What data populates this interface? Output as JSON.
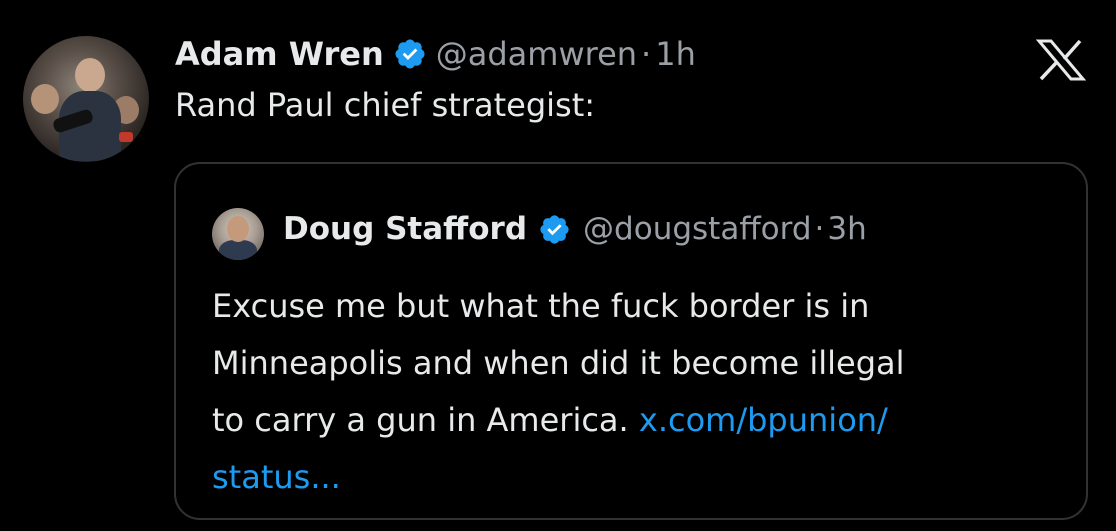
{
  "tweet": {
    "author_name": "Adam Wren",
    "handle": "@adamwren",
    "separator": "·",
    "time": "1h",
    "text": "Rand Paul chief strategist:"
  },
  "quote": {
    "author_name": "Doug Stafford",
    "handle": "@dougstafford",
    "separator": "·",
    "time": "3h",
    "lines": [
      "Excuse me but what the fuck border is in",
      "Minneapolis and when did it become illegal",
      "to carry a gun in America."
    ],
    "link_part1": "x.com/bpunion/",
    "link_part2": "status..."
  },
  "colors": {
    "background": "#000000",
    "text": "#e7e9ea",
    "secondary": "#9aa0a6",
    "link": "#1d9bf0",
    "verified": "#1d9bf0",
    "border": "#2f3336"
  },
  "icons": {
    "verified": "verified-badge-icon",
    "brand": "x-logo-icon"
  }
}
